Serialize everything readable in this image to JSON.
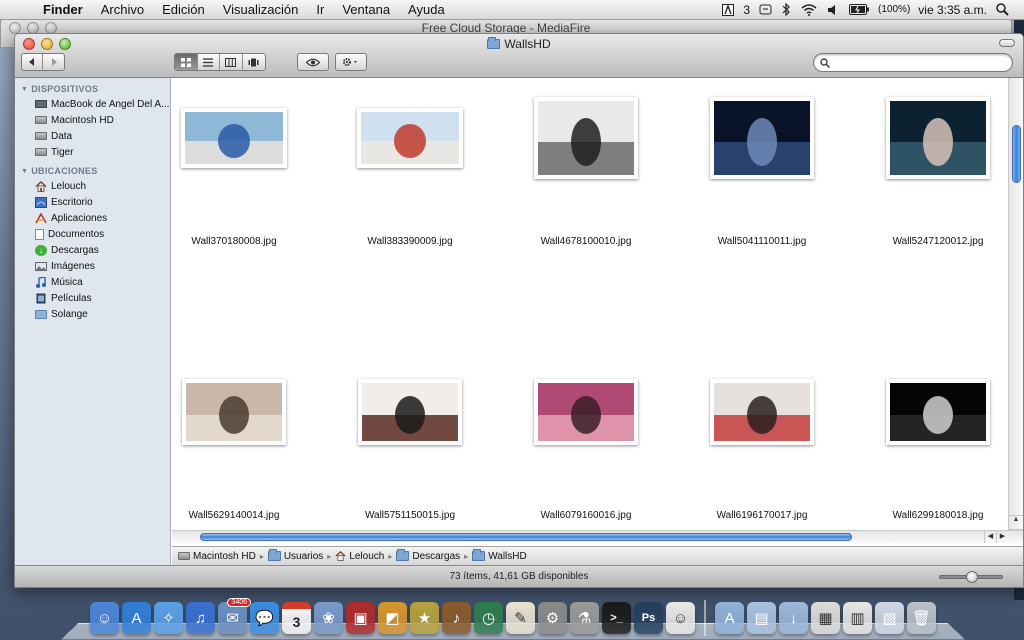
{
  "menubar": {
    "app": "Finder",
    "items": [
      "Archivo",
      "Edición",
      "Visualización",
      "Ir",
      "Ventana",
      "Ayuda"
    ],
    "status": {
      "adobe_count": "3",
      "battery": "(100%)",
      "clock": "vie 3:35 a.m."
    }
  },
  "back_window": {
    "title": "Free Cloud Storage - MediaFire"
  },
  "window": {
    "title": "WallsHD",
    "search": {
      "value": "",
      "placeholder": ""
    }
  },
  "sidebar": {
    "devices_header": "DISPOSITIVOS",
    "devices": [
      {
        "label": "MacBook de Angel Del A...",
        "icon": "laptop-icon"
      },
      {
        "label": "Macintosh HD",
        "icon": "hard-drive-icon"
      },
      {
        "label": "Data",
        "icon": "hard-drive-icon"
      },
      {
        "label": "Tiger",
        "icon": "hard-drive-icon"
      }
    ],
    "places_header": "UBICACIONES",
    "places": [
      {
        "label": "Lelouch",
        "icon": "home-icon"
      },
      {
        "label": "Escritorio",
        "icon": "desktop-icon"
      },
      {
        "label": "Aplicaciones",
        "icon": "applications-icon"
      },
      {
        "label": "Documentos",
        "icon": "document-icon"
      },
      {
        "label": "Descargas",
        "icon": "downloads-icon"
      },
      {
        "label": "Imágenes",
        "icon": "pictures-icon"
      },
      {
        "label": "Música",
        "icon": "music-icon"
      },
      {
        "label": "Películas",
        "icon": "movies-icon"
      },
      {
        "label": "Solange",
        "icon": "folder-icon"
      }
    ]
  },
  "files": [
    {
      "name": "Wall370180008.jpg",
      "colors": [
        "#8fb7d6",
        "#e9e4dc",
        "#2a5aa8"
      ]
    },
    {
      "name": "Wall383390009.jpg",
      "colors": [
        "#cfe0ee",
        "#ece8e2",
        "#c0392b"
      ]
    },
    {
      "name": "Wall4678100010.jpg",
      "colors": [
        "#e9e9e9",
        "#6b6b6b",
        "#1f1f1f"
      ]
    },
    {
      "name": "Wall5041110011.jpg",
      "colors": [
        "#0a1428",
        "#2d4a78",
        "#6e8ab8"
      ]
    },
    {
      "name": "Wall5247120012.jpg",
      "colors": [
        "#0d2230",
        "#355c6e",
        "#d8c3b8"
      ]
    },
    {
      "name": "Wall5629140014.jpg",
      "colors": [
        "#c9b8a7",
        "#e8ddd2",
        "#4a3a30"
      ]
    },
    {
      "name": "Wall5751150015.jpg",
      "colors": [
        "#f2ede8",
        "#5b2b22",
        "#1a1a1a"
      ]
    },
    {
      "name": "Wall6079160016.jpg",
      "colors": [
        "#b04a74",
        "#e8a0b5",
        "#3a1e28"
      ]
    },
    {
      "name": "Wall6196170017.jpg",
      "colors": [
        "#e6e1dc",
        "#c33c3c",
        "#2b2020"
      ]
    },
    {
      "name": "Wall6299180018.jpg",
      "colors": [
        "#050505",
        "#2a2a2a",
        "#cfcfcf"
      ]
    }
  ],
  "pathbar": [
    "Macintosh HD",
    "Usuarios",
    "Lelouch",
    "Descargas",
    "WallsHD"
  ],
  "status": "73 ítems, 41,61 GB disponibles",
  "dock": {
    "ical_day": "3",
    "mail_badge": "3406",
    "items": [
      "finder-icon",
      "app-store-icon",
      "safari-icon",
      "itunes-icon",
      "mail-icon",
      "ichat-icon",
      "ical-icon",
      "iphoto-icon",
      "photo-booth-icon",
      "preview-icon",
      "imovie-icon",
      "garageband-icon",
      "time-machine-icon",
      "textedit-icon",
      "system-preferences-icon",
      "utility-icon",
      "terminal-icon",
      "photoshop-icon",
      "messages-icon",
      "applications-stack-icon",
      "documents-stack-icon",
      "downloads-stack-icon",
      "network-icon",
      "stack-icon",
      "screenshot-icon",
      "trash-icon"
    ]
  }
}
